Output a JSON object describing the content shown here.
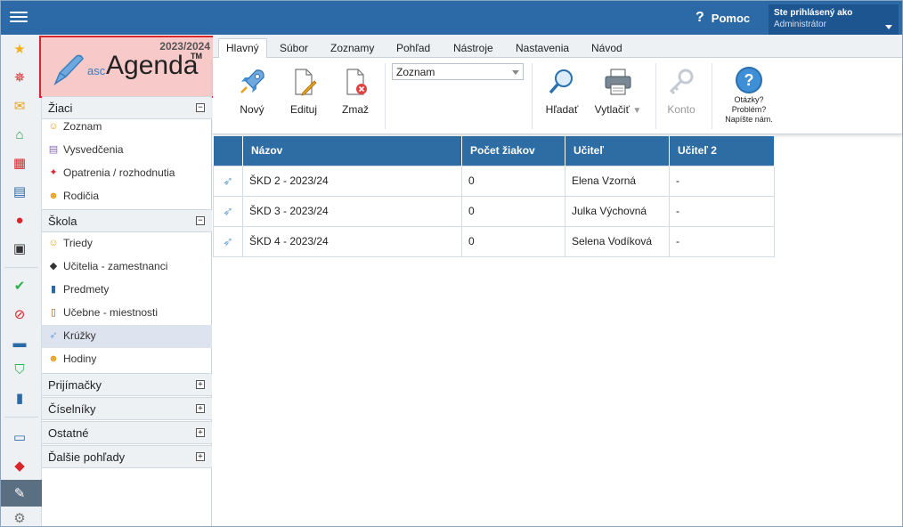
{
  "topbar": {
    "help_label": "Pomoc",
    "user_line1": "Ste prihlásený ako",
    "user_line2": "Administrátor"
  },
  "logo": {
    "year": "2023/2024",
    "asc": "asc",
    "agenda": "Agenda",
    "tm": "TM"
  },
  "tree": {
    "groups": [
      {
        "label": "Žiaci",
        "state": "−"
      },
      {
        "label": "Škola",
        "state": "−"
      },
      {
        "label": "Prijímačky",
        "state": "+"
      },
      {
        "label": "Číselníky",
        "state": "+"
      },
      {
        "label": "Ostatné",
        "state": "+"
      },
      {
        "label": "Ďalšie pohľady",
        "state": "+"
      }
    ],
    "ziaci_items": [
      {
        "label": "Zoznam",
        "icon": "person-icon"
      },
      {
        "label": "Vysvedčenia",
        "icon": "report-card-icon"
      },
      {
        "label": "Opatrenia / rozhodnutia",
        "icon": "pin-icon"
      },
      {
        "label": "Rodičia",
        "icon": "parents-icon"
      }
    ],
    "skola_items": [
      {
        "label": "Triedy",
        "icon": "class-icon"
      },
      {
        "label": "Učitelia - zamestnanci",
        "icon": "graduation-cap-icon"
      },
      {
        "label": "Predmety",
        "icon": "book-icon"
      },
      {
        "label": "Učebne - miestnosti",
        "icon": "door-icon"
      },
      {
        "label": "Krúžky",
        "icon": "rocket-icon"
      },
      {
        "label": "Hodiny",
        "icon": "group-icon"
      }
    ]
  },
  "ribbon": {
    "tabs": [
      "Hlavný",
      "Súbor",
      "Zoznamy",
      "Pohľad",
      "Nástroje",
      "Nastavenia",
      "Návod"
    ],
    "new_label": "Nový",
    "edit_label": "Edituj",
    "delete_label": "Zmaž",
    "view_select": "Zoznam",
    "search_label": "Hľadať",
    "print_label": "Vytlačiť",
    "account_label": "Konto",
    "help_line1": "Otázky?",
    "help_line2": "Problém?",
    "help_line3": "Napíšte nám."
  },
  "table": {
    "headers": [
      "Názov",
      "Počet žiakov",
      "Učiteľ",
      "Učiteľ 2"
    ],
    "rows": [
      {
        "name": "ŠKD 2 - 2023/24",
        "count": "0",
        "teacher": "Elena Vzorná",
        "teacher2": "-"
      },
      {
        "name": "ŠKD 3 - 2023/24",
        "count": "0",
        "teacher": "Julka Výchovná",
        "teacher2": "-"
      },
      {
        "name": "ŠKD 4 - 2023/24",
        "count": "0",
        "teacher": "Selena Vodíková",
        "teacher2": "-"
      }
    ]
  },
  "colors": {
    "topbar": "#2b6aa6",
    "header": "#2e6da4",
    "logo_bg": "#f7c9c9",
    "logo_border": "#d9262b"
  }
}
